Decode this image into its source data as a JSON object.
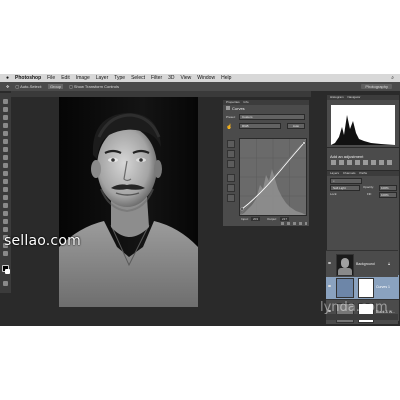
{
  "menubar": {
    "app_name": "Photoshop",
    "items": [
      "File",
      "Edit",
      "Image",
      "Layer",
      "Type",
      "Select",
      "Filter",
      "3D",
      "View",
      "Window",
      "Help"
    ]
  },
  "options_bar": {
    "auto_select_label": "Auto-Select:",
    "auto_select_value": "Group",
    "transform_label": "Show Transform Controls",
    "workspace": "Photography"
  },
  "properties_panel": {
    "tabs": [
      "Properties",
      "Info"
    ],
    "title": "Curves",
    "preset_label": "Preset:",
    "preset_value": "Custom",
    "channel_value": "RGB",
    "auto_button": "Auto",
    "input_label": "Input:",
    "input_value": "203",
    "output_label": "Output:",
    "output_value": "217"
  },
  "histogram_panel": {
    "tabs": [
      "Histogram",
      "Navigator"
    ]
  },
  "adjustments_panel": {
    "title": "Add an adjustment"
  },
  "layers_panel": {
    "tabs": [
      "Layers",
      "Channels",
      "Paths"
    ],
    "blend_mode": "Soft Light",
    "opacity_label": "Opacity:",
    "opacity_value": "100%",
    "fill_label": "Fill:",
    "fill_value": "100%",
    "lock_label": "Lock:",
    "layers": [
      {
        "name": "Curves 1",
        "selected": true
      },
      {
        "name": "Black & W...",
        "selected": false
      },
      {
        "name": "Background",
        "selected": false
      }
    ]
  },
  "watermarks": {
    "site": "sellao.com",
    "brand": "lynda.com"
  },
  "colors": {
    "selected_layer": "#8aa2bf",
    "panel": "#4b4b4b",
    "workspace": "#2a2a2a"
  }
}
